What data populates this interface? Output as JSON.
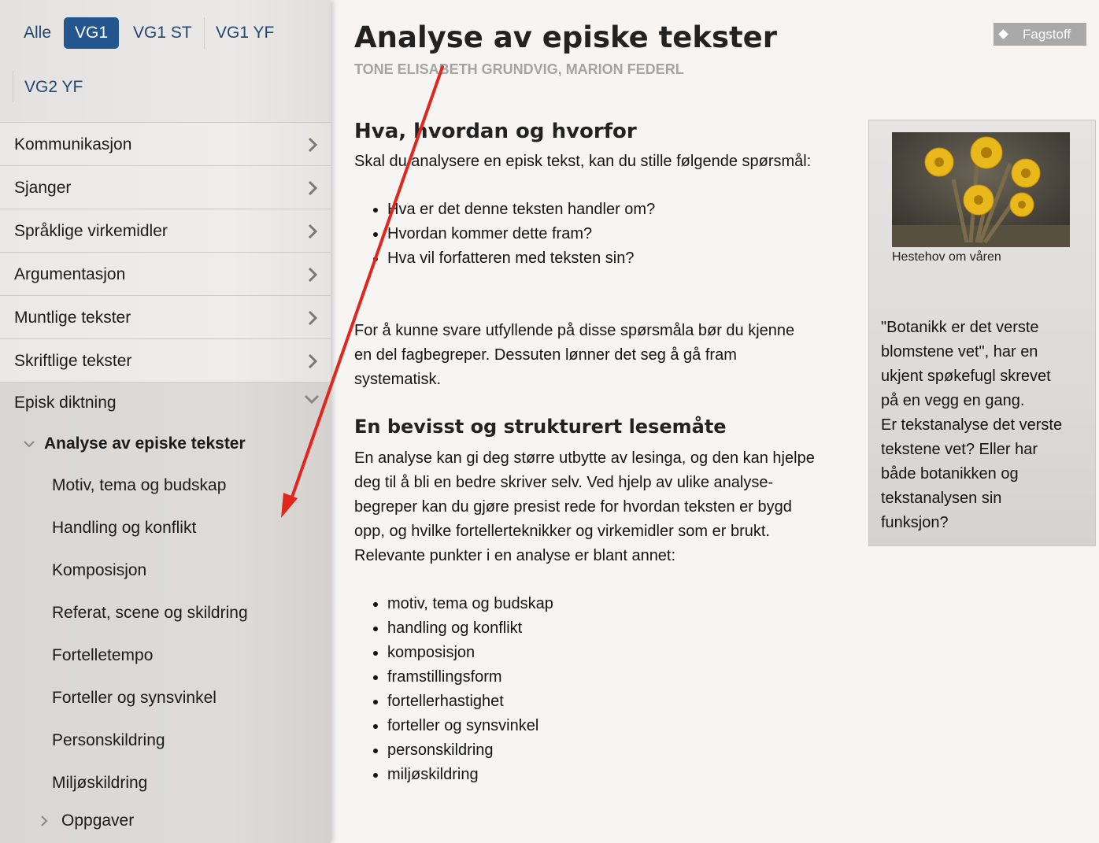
{
  "levels": {
    "all": "Alle",
    "vg1": "VG1",
    "vg1st": "VG1 ST",
    "vg1yf": "VG1 YF",
    "vg2yf": "VG2 YF",
    "active_color": "#23558f"
  },
  "nav": {
    "items": [
      {
        "label": "Kommunikasjon"
      },
      {
        "label": "Sjanger"
      },
      {
        "label": "Språklige virkemidler"
      },
      {
        "label": "Argumentasjon"
      },
      {
        "label": "Muntlige tekster"
      },
      {
        "label": "Skriftlige tekster"
      }
    ],
    "open_section": "Episk diktning",
    "active_item": "Analyse av episke tekster",
    "sub_items": [
      {
        "label": "Motiv, tema og budskap"
      },
      {
        "label": "Handling og konflikt"
      },
      {
        "label": "Komposisjon"
      },
      {
        "label": "Referat, scene og skildring"
      },
      {
        "label": "Fortelletempo"
      },
      {
        "label": "Forteller og synsvinkel"
      },
      {
        "label": "Personskildring"
      },
      {
        "label": "Miljøskildring"
      }
    ],
    "tasks": "Oppgaver"
  },
  "article": {
    "title": "Analyse av episke tekster",
    "authors": "TONE ELISABETH GRUNDVIG, MARION FEDERL",
    "badge": "Fagstoff",
    "section1_heading": "Hva, hvordan og hvorfor",
    "section1_intro": "Skal du analysere en episk tekst, kan du stille følgende spørsmål:",
    "questions": [
      "Hva er det denne teksten handler om?",
      "Hvordan kommer dette fram?",
      "Hva vil forfatteren med teksten sin?"
    ],
    "section1_para": [
      "For å kunne svare utfyllende på disse spørsmåla bør du kjenne",
      "en del fagbegreper. Dessuten lønner det seg å gå fram",
      "systematisk."
    ],
    "section2_heading": "En bevisst og strukturert lesemåte",
    "section2_para": [
      "En analyse kan gi deg større utbytte av lesinga, og den kan hjelpe",
      "deg til å bli en bedre skriver selv. Ved hjelp av ulike analyse-",
      "begreper kan du gjøre presist rede for hvordan teksten er bygd",
      "opp, og hvilke fortellerteknikker og virkemidler som er brukt.",
      "Relevante punkter i en analyse er blant annet:"
    ],
    "points": [
      "motiv, tema og budskap",
      "handling og konflikt",
      "komposisjon",
      "framstillingsform",
      "fortellerhastighet",
      "forteller og synsvinkel",
      "personskildring",
      "miljøskildring"
    ]
  },
  "aside": {
    "caption": "Hestehov om våren",
    "quote": [
      "\"Botanikk er det verste",
      "blomstene vet\", har en",
      "ukjent spøkefugl skrevet",
      "på en vegg en gang.",
      "Er tekstanalyse det verste",
      "tekstene vet? Eller har",
      "både botanikken og",
      "tekstanalysen sin",
      "funksjon?"
    ]
  },
  "annotation_color": "#e0261d"
}
